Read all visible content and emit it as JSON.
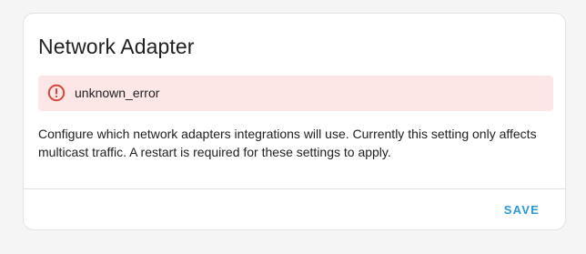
{
  "card": {
    "title": "Network Adapter",
    "alert": {
      "icon": "alert-circle-icon",
      "text": "unknown_error",
      "color": "#db4437"
    },
    "description": "Configure which network adapters integrations will use. Currently this setting only affects multicast traffic. A restart is required for these settings to apply.",
    "save_label": "SAVE"
  },
  "colors": {
    "accent": "#2a9ad4",
    "error_bg": "#fce6e6",
    "error": "#db4437"
  }
}
